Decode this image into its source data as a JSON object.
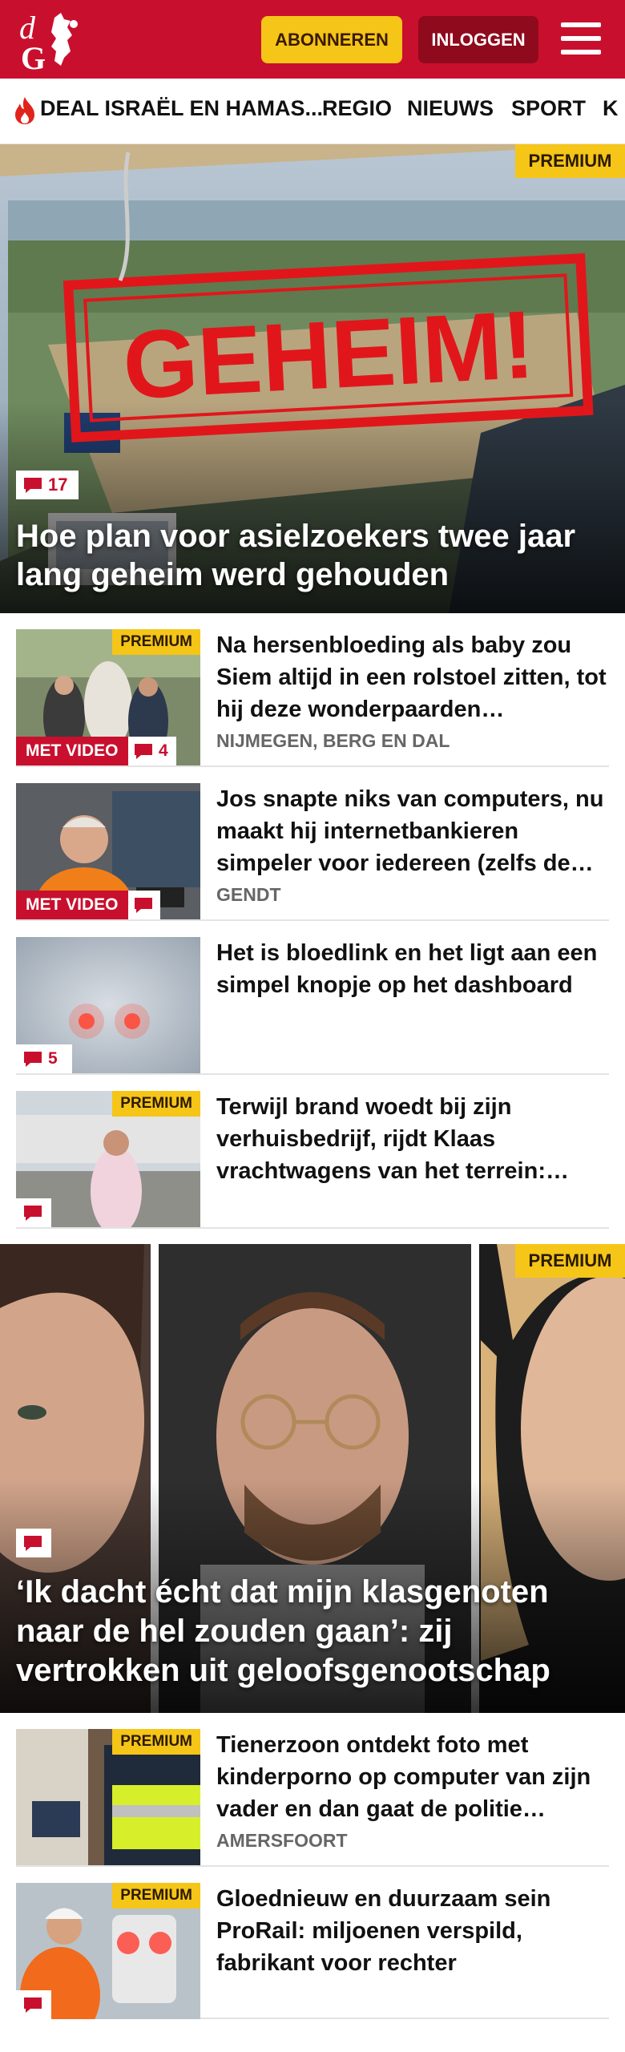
{
  "header": {
    "subscribe_label": "ABONNEREN",
    "login_label": "INLOGGEN",
    "brand_color": "#c8102e"
  },
  "nav": {
    "items": [
      {
        "label": "DEAL ISRAËL EN HAMAS..."
      },
      {
        "label": "REGIO"
      },
      {
        "label": "NIEUWS"
      },
      {
        "label": "SPORT"
      },
      {
        "label": "K"
      }
    ]
  },
  "hero": {
    "premium_label": "PREMIUM",
    "stamp_text": "GEHEIM!",
    "comments": "17",
    "title": "Hoe plan voor asielzoekers twee jaar lang geheim werd gehouden"
  },
  "articles": [
    {
      "premium_label": "PREMIUM",
      "video_label": "MET VIDEO",
      "comments": "4",
      "title": "Na hersenbloeding als baby zou Siem altijd in een rolstoel zitten, tot hij deze wonderpaarden…",
      "location": "NIJMEGEN, BERG EN DAL"
    },
    {
      "video_label": "MET VIDEO",
      "title": "Jos snapte niks van computers, nu maakt hij internetbankieren simpeler voor iedereen (zelfs de…",
      "location": "GENDT"
    },
    {
      "comments": "5",
      "title": "Het is bloedlink en het ligt aan een simpel knopje op het dashboard"
    },
    {
      "premium_label": "PREMIUM",
      "title": "Terwijl brand woedt bij zijn verhuisbedrijf, rijdt Klaas vrachtwagens van het terrein:…"
    }
  ],
  "feature": {
    "premium_label": "PREMIUM",
    "title": "‘Ik dacht écht dat mijn klasgenoten naar de hel zouden gaan’: zij vertrokken uit geloofsgenootschap"
  },
  "articles2": [
    {
      "premium_label": "PREMIUM",
      "title": "Tienerzoon ontdekt foto met kinderporno op computer van zijn vader en dan gaat de politie…",
      "location": "AMERSFOORT"
    },
    {
      "premium_label": "PREMIUM",
      "title": "Gloednieuw en duurzaam sein ProRail: miljoenen verspild, fabrikant voor rechter"
    }
  ]
}
